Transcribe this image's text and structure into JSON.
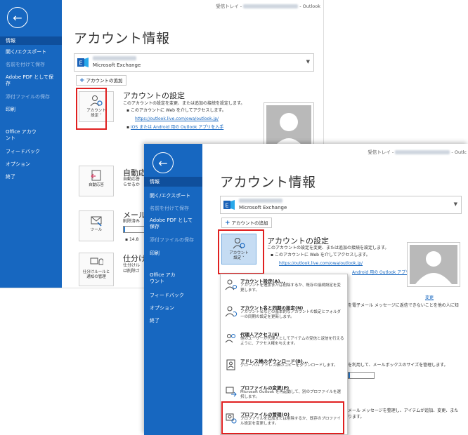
{
  "shot1": {
    "breadcrumb_prefix": "受信トレイ -",
    "breadcrumb_suffix": "- Outlook",
    "nav": [
      "情報",
      "開く/エクスポート",
      "名前を付けて保存",
      "Adobe PDF として保存",
      "添付ファイルの保存",
      "印刷",
      "Office アカウント",
      "フィードバック",
      "オプション",
      "終了"
    ],
    "page_title": "アカウント情報",
    "account_type": "Microsoft Exchange",
    "add_account": "アカウントの追加",
    "tile_account_settings": "アカウント\n設定 ˅",
    "account_settings_title": "アカウントの設定",
    "account_settings_desc": "このアカウントの設定を変更、または追加の接続を設定します。",
    "account_settings_bullet": "このアカウントに Web を介してアクセスします。",
    "owa_link": "https://outlook.live.com/owa/outlook.jp/",
    "mobile_link": "iOS または Android 用の Outlook アプリを入手",
    "tile_auto_reply": "自動応答",
    "auto_reply_title": "自動応",
    "auto_reply_desc1": "自動応答",
    "auto_reply_desc2": "らせるか",
    "tile_tools": "ツール",
    "mailbox_title": "メール",
    "mailbox_desc": "削除済み",
    "mailbox_size": "14.8",
    "tile_rules": "仕分けルールと\n通知の管理",
    "rules_title": "仕分け",
    "rules_desc1": "仕分けル",
    "rules_desc2": "は削除さ"
  },
  "shot2": {
    "breadcrumb_prefix": "受信トレイ -",
    "breadcrumb_suffix": "- Outlc",
    "nav": [
      "情報",
      "開く/エクスポート",
      "名前を付けて保存",
      "Adobe PDF として保存",
      "添付ファイルの保存",
      "印刷",
      "Office アカウント",
      "フィードバック",
      "オプション",
      "終了"
    ],
    "page_title": "アカウント情報",
    "account_type": "Microsoft Exchange",
    "add_account": "アカウントの追加",
    "tile_account_settings": "アカウント\n設定 ˅",
    "account_settings_title": "アカウントの設定",
    "account_settings_desc": "このアカウントの設定を変更、または追加の接続を設定します。",
    "account_settings_bullet": "このアカウントに Web を介してアクセスします。",
    "owa_link": "https://outlook.live.com/owa/outlook.jp/",
    "mobile_link_tail": "Android 用の Outlook アプリを入手",
    "change_link": "変更",
    "auto_reply_tail": "を電子メール メッセージに返信できないことを他の人に知",
    "mailbox_tail": "を利用して、メールボックスのサイズを管理します。",
    "rules_tail": "メール メッセージを整理し、アイテムが追加、変更、また",
    "rules_tail2": "ります。",
    "menu": [
      {
        "title": "アカウント設定(A)...",
        "desc": "アカウントを追加または削除するか、既存の接続設定を変更します。"
      },
      {
        "title": "アカウント名と同期の設定(N)",
        "desc": "アカウント名などの基本的なアカウントの設定とフォルダーの同期の設定を更新します。"
      },
      {
        "title": "代理人アクセス(E)",
        "desc": "他のユーザーが代理人としてアイテムの受信と返信を行えるように、アクセス権を与えます。"
      },
      {
        "title": "アドレス帳のダウンロード(B)...",
        "desc": "グローバル アドレス帳のコピーをダウンロードします。"
      },
      {
        "title": "プロファイルの変更(P)",
        "desc": "Microsoft Outlook を再起動して、別のプロファイルを選択します。"
      },
      {
        "title": "プロファイルの管理(O)",
        "desc": "プロファイルを追加または削除するか、既存のプロファイル設定を変更します。"
      }
    ]
  },
  "colors": {
    "sidebar": "#1767c0",
    "highlight": "#e02020",
    "link": "#1767c0"
  }
}
